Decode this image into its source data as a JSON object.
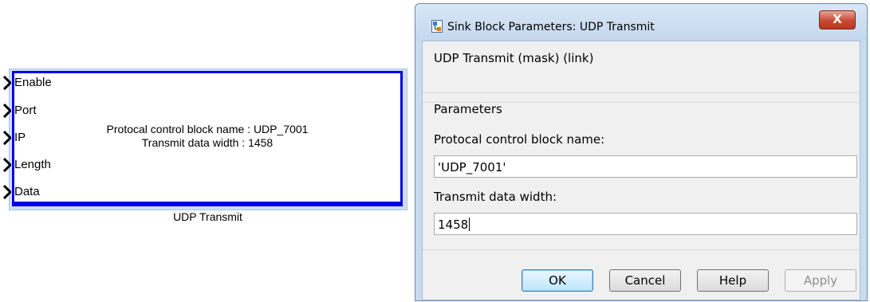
{
  "block": {
    "ports": [
      "Enable",
      "Port",
      "IP",
      "Length",
      "Data"
    ],
    "text_line1": "Protocal control block name : UDP_7001",
    "text_line2": "Transmit data width : 1458",
    "name": "UDP Transmit"
  },
  "dialog": {
    "title": "Sink Block Parameters: UDP Transmit",
    "close_label": "X",
    "mask_title": "UDP Transmit (mask) (link)",
    "parameters_title": "Parameters",
    "field1_label": "Protocal control block name:",
    "field1_value": "'UDP_7001'",
    "field2_label": "Transmit data width:",
    "field2_value": "1458",
    "buttons": {
      "ok": "OK",
      "cancel": "Cancel",
      "help": "Help",
      "apply": "Apply"
    }
  },
  "colors": {
    "block_border": "#0000e6",
    "dialog_frame": "#c9dbef",
    "close_button": "#c74a33"
  }
}
